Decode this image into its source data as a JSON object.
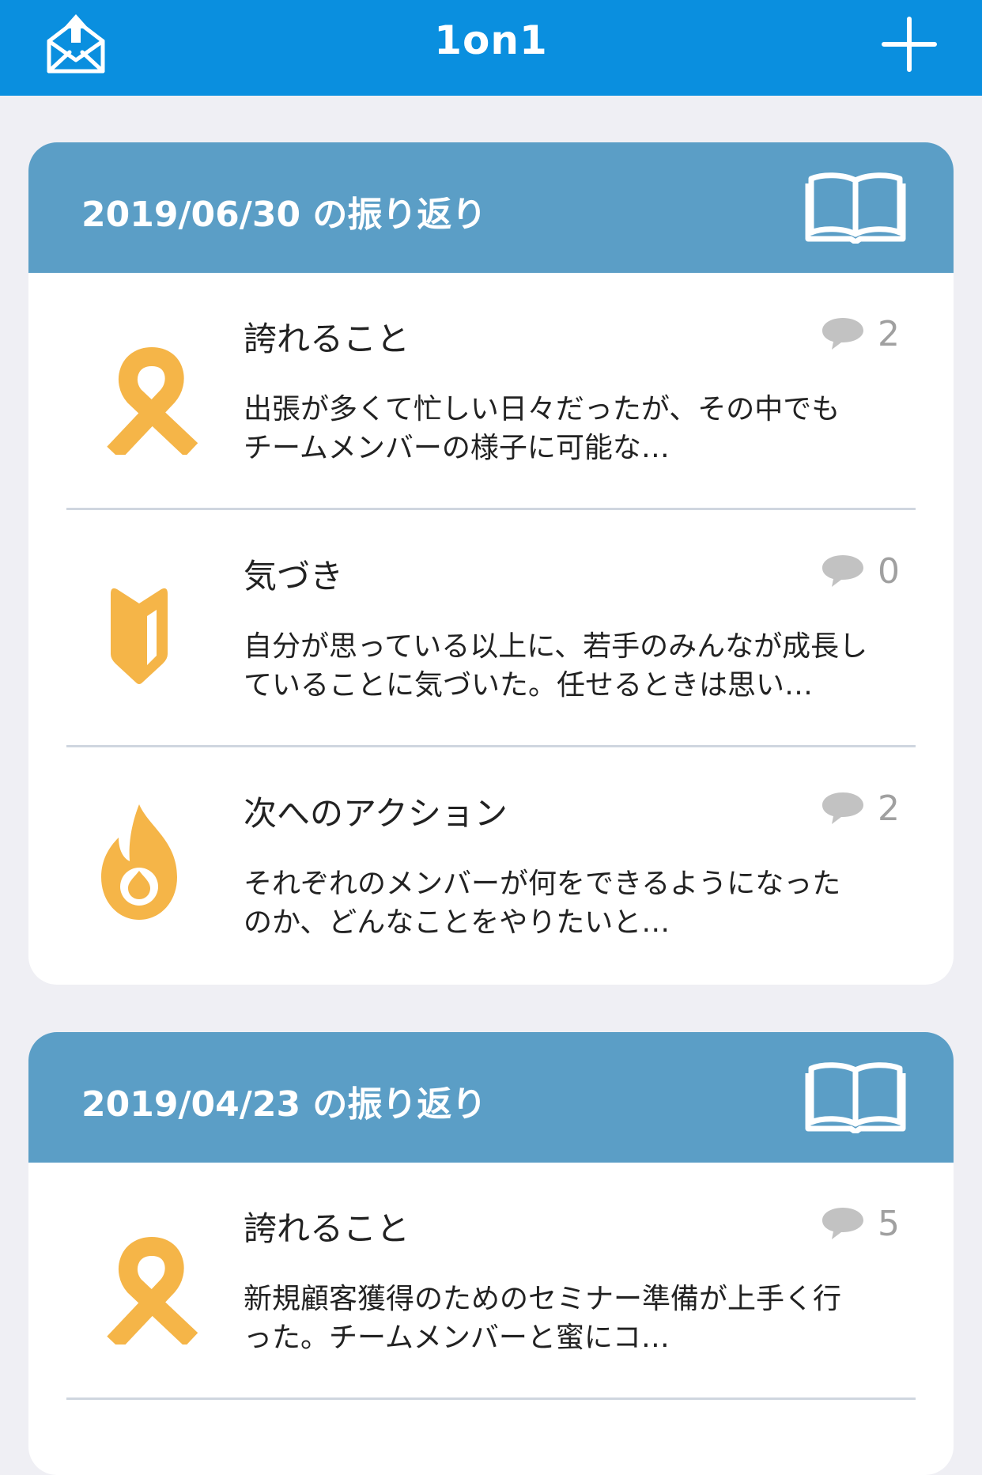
{
  "nav": {
    "title": "1on1",
    "left_icon": "envelope-upload-icon",
    "right_icon": "plus-icon"
  },
  "colors": {
    "nav_bar": "#0a8fdf",
    "card_header": "#5b9ec6",
    "category_icon": "#f5b548",
    "comment_count": "#a0a0a0",
    "background": "#efeff4"
  },
  "reviews": [
    {
      "date_title": "2019/06/30 の振り返り",
      "header_icon": "open-book-icon",
      "items": [
        {
          "icon": "ribbon-icon",
          "title": "誇れること",
          "comment_count": "2",
          "text": "出張が多くて忙しい日々だったが、その中でもチームメンバーの様子に可能な…"
        },
        {
          "icon": "beginner-mark-icon",
          "title": "気づき",
          "comment_count": "0",
          "text": "自分が思っている以上に、若手のみんなが成長していることに気づいた。任せるときは思い…"
        },
        {
          "icon": "flame-icon",
          "title": "次へのアクション",
          "comment_count": "2",
          "text": "それぞれのメンバーが何をできるようになったのか、どんなことをやりたいと…"
        }
      ]
    },
    {
      "date_title": "2019/04/23 の振り返り",
      "header_icon": "open-book-icon",
      "items": [
        {
          "icon": "ribbon-icon",
          "title": "誇れること",
          "comment_count": "5",
          "text": "新規顧客獲得のためのセミナー準備が上手く行った。チームメンバーと蜜にコ…"
        }
      ]
    }
  ]
}
